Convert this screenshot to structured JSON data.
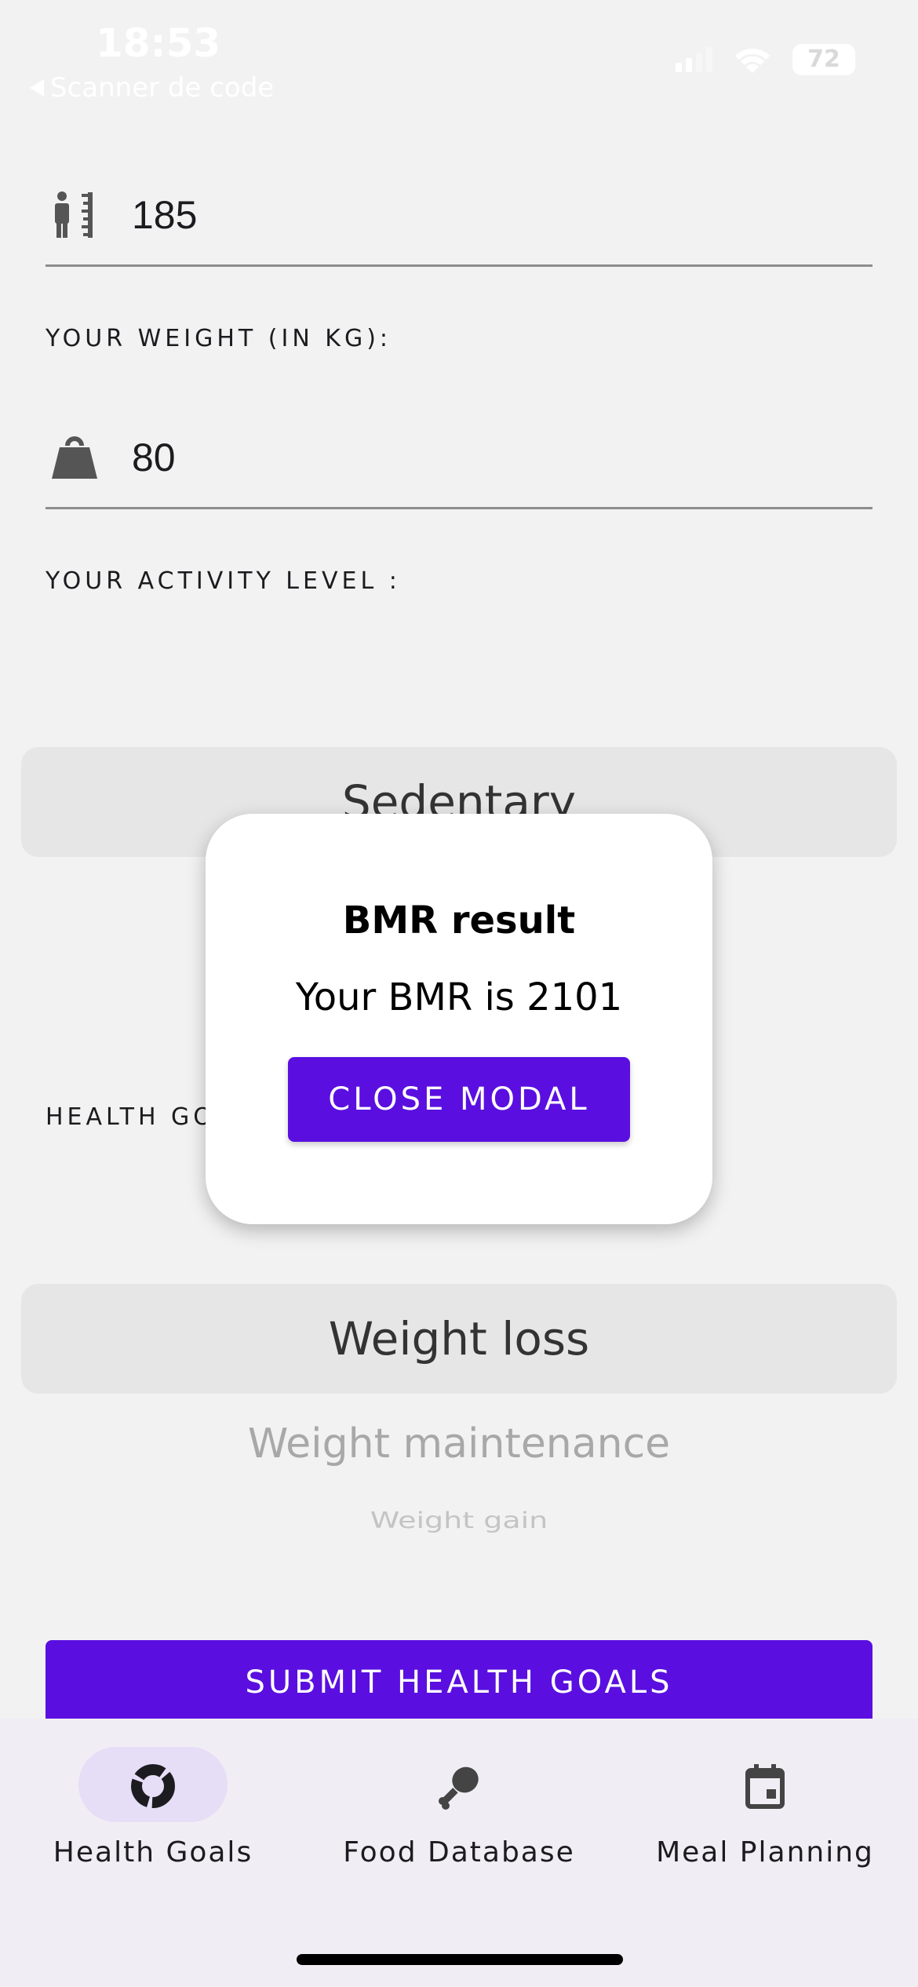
{
  "status_bar": {
    "time": "18:53",
    "back_label": "Scanner de code",
    "battery": "72"
  },
  "form": {
    "height_value": "185",
    "weight_label": "YOUR WEIGHT (IN KG):",
    "weight_value": "80",
    "activity_label": "YOUR ACTIVITY LEVEL :",
    "activity_selected": "Sedentary",
    "health_goal_label": "HEALTH GOALS :",
    "health_goal_options": [
      "Weight loss",
      "Weight maintenance",
      "Weight gain"
    ],
    "submit_label": "SUBMIT HEALTH GOALS"
  },
  "modal": {
    "title": "BMR result",
    "message": "Your BMR is 2101",
    "close_label": "CLOSE MODAL"
  },
  "bottom_nav": {
    "items": [
      {
        "label": "Health Goals",
        "icon": "donut-chart-icon",
        "active": true
      },
      {
        "label": "Food Database",
        "icon": "drumstick-icon",
        "active": false
      },
      {
        "label": "Meal Planning",
        "icon": "calendar-icon",
        "active": false
      }
    ]
  },
  "colors": {
    "accent": "#5a0fe0",
    "nav_background": "#f1edf4",
    "active_pill": "#e6ddf6"
  }
}
